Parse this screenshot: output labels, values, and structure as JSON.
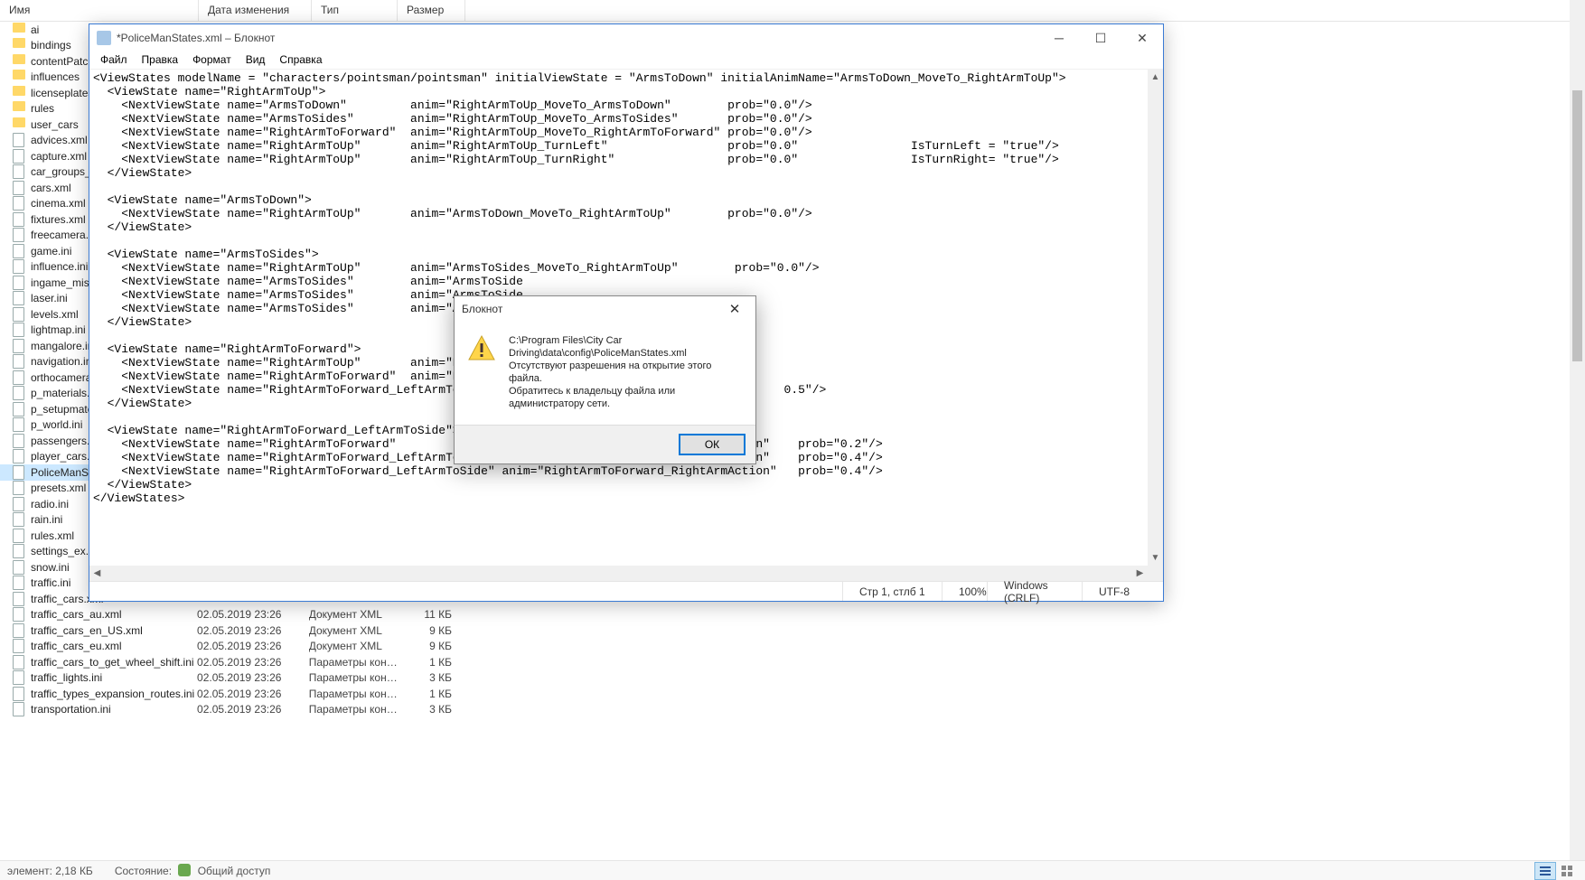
{
  "explorer": {
    "columns": {
      "name": "Имя",
      "date": "Дата изменения",
      "type": "Тип",
      "size": "Размер"
    },
    "items": [
      {
        "icon": "folder",
        "name": "ai"
      },
      {
        "icon": "folder",
        "name": "bindings"
      },
      {
        "icon": "folder",
        "name": "contentPatches"
      },
      {
        "icon": "folder",
        "name": "influences"
      },
      {
        "icon": "folder",
        "name": "licenseplates"
      },
      {
        "icon": "folder",
        "name": "rules"
      },
      {
        "icon": "folder",
        "name": "user_cars"
      },
      {
        "icon": "file",
        "name": "advices.xml"
      },
      {
        "icon": "file",
        "name": "capture.xml"
      },
      {
        "icon": "file",
        "name": "car_groups_settir"
      },
      {
        "icon": "file",
        "name": "cars.xml"
      },
      {
        "icon": "file",
        "name": "cinema.xml"
      },
      {
        "icon": "file",
        "name": "fixtures.xml"
      },
      {
        "icon": "file",
        "name": "freecamera.ini"
      },
      {
        "icon": "file",
        "name": "game.ini"
      },
      {
        "icon": "file",
        "name": "influence.ini"
      },
      {
        "icon": "file",
        "name": "ingame_mission"
      },
      {
        "icon": "file",
        "name": "laser.ini"
      },
      {
        "icon": "file",
        "name": "levels.xml"
      },
      {
        "icon": "file",
        "name": "lightmap.ini"
      },
      {
        "icon": "file",
        "name": "mangalore.ini"
      },
      {
        "icon": "file",
        "name": "navigation.ini"
      },
      {
        "icon": "file",
        "name": "orthocamera.ini"
      },
      {
        "icon": "file",
        "name": "p_materials.xml"
      },
      {
        "icon": "file",
        "name": "p_setupmaterial"
      },
      {
        "icon": "file",
        "name": "p_world.ini"
      },
      {
        "icon": "file",
        "name": "passengers.ini"
      },
      {
        "icon": "file",
        "name": "player_cars.xml"
      },
      {
        "icon": "file",
        "name": "PoliceManStates",
        "selected": true
      },
      {
        "icon": "file",
        "name": "presets.xml"
      },
      {
        "icon": "file",
        "name": "radio.ini"
      },
      {
        "icon": "file",
        "name": "rain.ini"
      },
      {
        "icon": "file",
        "name": "rules.xml"
      },
      {
        "icon": "file",
        "name": "settings_ex.ini"
      },
      {
        "icon": "file",
        "name": "snow.ini"
      },
      {
        "icon": "file",
        "name": "traffic.ini"
      },
      {
        "icon": "file",
        "name": "traffic_cars.xml"
      },
      {
        "icon": "file",
        "name": "traffic_cars_au.xml",
        "date": "02.05.2019 23:26",
        "type": "Документ XML",
        "size": "11 КБ"
      },
      {
        "icon": "file",
        "name": "traffic_cars_en_US.xml",
        "date": "02.05.2019 23:26",
        "type": "Документ XML",
        "size": "9 КБ"
      },
      {
        "icon": "file",
        "name": "traffic_cars_eu.xml",
        "date": "02.05.2019 23:26",
        "type": "Документ XML",
        "size": "9 КБ"
      },
      {
        "icon": "file",
        "name": "traffic_cars_to_get_wheel_shift.ini",
        "date": "02.05.2019 23:26",
        "type": "Параметры конф...",
        "size": "1 КБ"
      },
      {
        "icon": "file",
        "name": "traffic_lights.ini",
        "date": "02.05.2019 23:26",
        "type": "Параметры конф...",
        "size": "3 КБ"
      },
      {
        "icon": "file",
        "name": "traffic_types_expansion_routes.ini",
        "date": "02.05.2019 23:26",
        "type": "Параметры конф...",
        "size": "1 КБ"
      },
      {
        "icon": "file",
        "name": "transportation.ini",
        "date": "02.05.2019 23:26",
        "type": "Параметры конф...",
        "size": "3 КБ"
      }
    ],
    "hidden_date": "02.05.2019 23:26",
    "hidden_type": "Документ XML",
    "hidden_size_placeholder": "КБ"
  },
  "status": {
    "element_label": "элемент: 2,18 КБ",
    "state_label": "Состояние:",
    "shared": "Общий доступ"
  },
  "notepad": {
    "title": "*PoliceManStates.xml – Блокнот",
    "menu": {
      "file": "Файл",
      "edit": "Правка",
      "format": "Формат",
      "view": "Вид",
      "help": "Справка"
    },
    "content": "<ViewStates modelName = \"characters/pointsman/pointsman\" initialViewState = \"ArmsToDown\" initialAnimName=\"ArmsToDown_MoveTo_RightArmToUp\">\n  <ViewState name=\"RightArmToUp\">\n    <NextViewState name=\"ArmsToDown\"         anim=\"RightArmToUp_MoveTo_ArmsToDown\"        prob=\"0.0\"/>\n    <NextViewState name=\"ArmsToSides\"        anim=\"RightArmToUp_MoveTo_ArmsToSides\"       prob=\"0.0\"/>\n    <NextViewState name=\"RightArmToForward\"  anim=\"RightArmToUp_MoveTo_RightArmToForward\" prob=\"0.0\"/>\n    <NextViewState name=\"RightArmToUp\"       anim=\"RightArmToUp_TurnLeft\"                 prob=\"0.0\"                IsTurnLeft = \"true\"/>\n    <NextViewState name=\"RightArmToUp\"       anim=\"RightArmToUp_TurnRight\"                prob=\"0.0\"                IsTurnRight= \"true\"/>\n  </ViewState>\n\n  <ViewState name=\"ArmsToDown\">\n    <NextViewState name=\"RightArmToUp\"       anim=\"ArmsToDown_MoveTo_RightArmToUp\"        prob=\"0.0\"/>\n  </ViewState>\n\n  <ViewState name=\"ArmsToSides\">\n    <NextViewState name=\"RightArmToUp\"       anim=\"ArmsToSides_MoveTo_RightArmToUp\"        prob=\"0.0\"/>\n    <NextViewState name=\"ArmsToSides\"        anim=\"ArmsToSide\n    <NextViewState name=\"ArmsToSides\"        anim=\"ArmsToSide\n    <NextViewState name=\"ArmsToSides\"        anim=\"ArmsToSide\n  </ViewState>\n\n  <ViewState name=\"RightArmToForward\">\n    <NextViewState name=\"RightArmToUp\"       anim=\"RightArmTo\n    <NextViewState name=\"RightArmToForward\"  anim=\"RightArmTo\n    <NextViewState name=\"RightArmToForward_LeftArmToSide\" an                                      0.5\"/>\n  </ViewState>\n\n  <ViewState name=\"RightArmToForward_LeftArmToSide\">\n    <NextViewState name=\"RightArmToForward\"               anim=\"RightArmToForward_LeftArmToDown\"    prob=\"0.2\"/>\n    <NextViewState name=\"RightArmToForward_LeftArmToSide\" anim=\"RightArmToForward_LeftArmAction\"    prob=\"0.4\"/>\n    <NextViewState name=\"RightArmToForward_LeftArmToSide\" anim=\"RightArmToForward_RightArmAction\"   prob=\"0.4\"/>\n  </ViewState>\n</ViewStates>",
    "statusbar": {
      "pos": "Стр 1, стлб 1",
      "zoom": "100%",
      "eol": "Windows (CRLF)",
      "enc": "UTF-8"
    }
  },
  "dialog": {
    "title": "Блокнот",
    "line1": "C:\\Program Files\\City Car",
    "line2": "Driving\\data\\config\\PoliceManStates.xml",
    "line3": "Отсутствуют разрешения на открытие этого файла.",
    "line4": "Обратитесь к владельцу файла или администратору сети.",
    "ok": "ОК"
  }
}
